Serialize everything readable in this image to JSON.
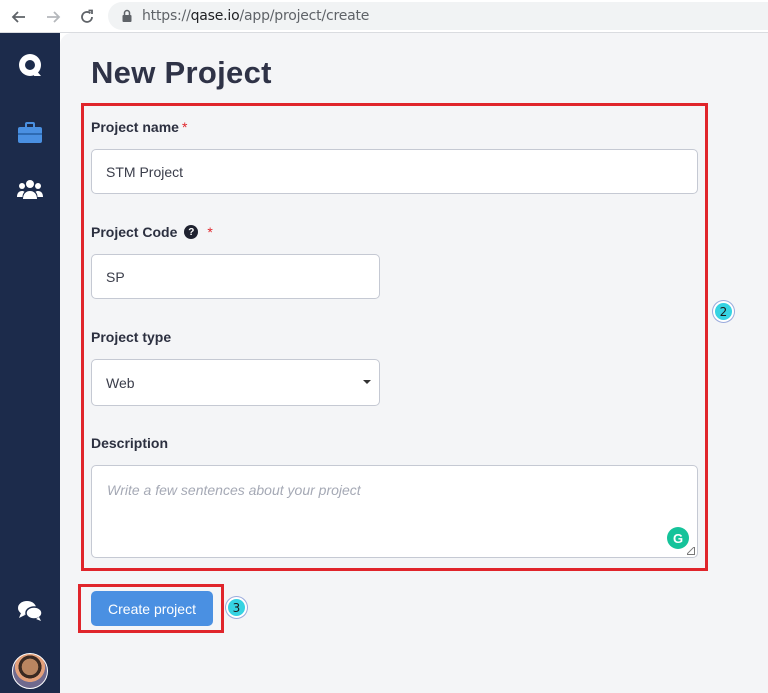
{
  "browser": {
    "url_scheme": "https://",
    "url_host": "qase.io",
    "url_path": "/app/project/create"
  },
  "sidebar": {
    "icons": [
      "qase-logo-icon",
      "briefcase-icon",
      "users-icon",
      "chat-icon",
      "avatar"
    ]
  },
  "page": {
    "title": "New Project"
  },
  "form": {
    "project_name_label": "Project name",
    "project_name_value": "STM Project",
    "project_code_label": "Project Code",
    "project_code_value": "SP",
    "project_type_label": "Project type",
    "project_type_value": "Web",
    "description_label": "Description",
    "description_placeholder": "Write a few sentences about your project",
    "required_mark": "*"
  },
  "actions": {
    "create_label": "Create project"
  },
  "annotations": {
    "badge_2": "2",
    "badge_3": "3"
  },
  "colors": {
    "sidebar": "#1c2b4b",
    "accent": "#4a90e2",
    "highlight": "#e0252b",
    "badge": "#36d3e2"
  }
}
